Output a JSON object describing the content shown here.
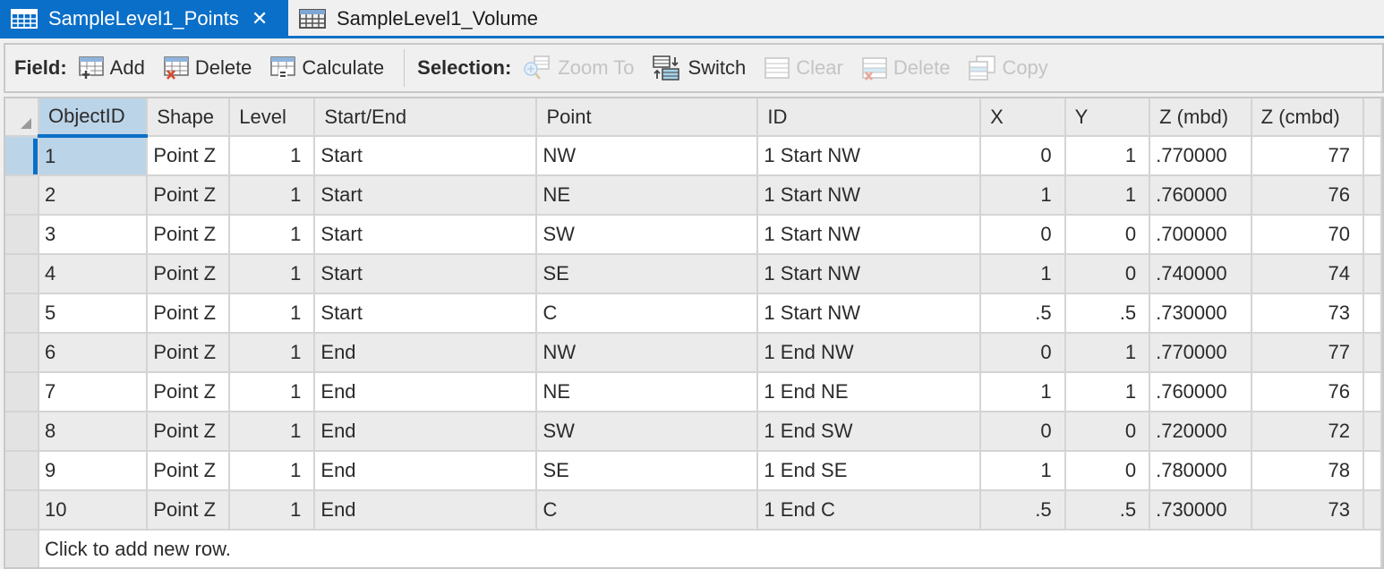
{
  "tabs": [
    {
      "label": "SampleLevel1_Points",
      "active": true,
      "closable": true,
      "icon": "table-icon"
    },
    {
      "label": "SampleLevel1_Volume",
      "active": false,
      "closable": false,
      "icon": "table-icon"
    }
  ],
  "toolbar": {
    "field_label": "Field:",
    "field_buttons": [
      {
        "label": "Add",
        "icon": "add-field-icon",
        "enabled": true
      },
      {
        "label": "Delete",
        "icon": "delete-field-icon",
        "enabled": true
      },
      {
        "label": "Calculate",
        "icon": "calculate-field-icon",
        "enabled": true
      }
    ],
    "selection_label": "Selection:",
    "selection_buttons": [
      {
        "label": "Zoom To",
        "icon": "zoom-to-icon",
        "enabled": false
      },
      {
        "label": "Switch",
        "icon": "switch-selection-icon",
        "enabled": true
      },
      {
        "label": "Clear",
        "icon": "clear-selection-icon",
        "enabled": false
      },
      {
        "label": "Delete",
        "icon": "delete-selection-icon",
        "enabled": false
      },
      {
        "label": "Copy",
        "icon": "copy-selection-icon",
        "enabled": false
      }
    ]
  },
  "table": {
    "columns": [
      "ObjectID",
      "Shape",
      "Level",
      "Start/End",
      "Point",
      "ID",
      "X",
      "Y",
      "Z (mbd)",
      "Z (cmbd)"
    ],
    "selected_column": "ObjectID",
    "selected_row": 0,
    "rows": [
      [
        "1",
        "Point Z",
        "1",
        "Start",
        "NW",
        "1 Start NW",
        "0",
        "1",
        ".770000",
        "77"
      ],
      [
        "2",
        "Point Z",
        "1",
        "Start",
        "NE",
        "1 Start NW",
        "1",
        "1",
        ".760000",
        "76"
      ],
      [
        "3",
        "Point Z",
        "1",
        "Start",
        "SW",
        "1 Start NW",
        "0",
        "0",
        ".700000",
        "70"
      ],
      [
        "4",
        "Point Z",
        "1",
        "Start",
        "SE",
        "1 Start NW",
        "1",
        "0",
        ".740000",
        "74"
      ],
      [
        "5",
        "Point Z",
        "1",
        "Start",
        "C",
        "1 Start NW",
        ".5",
        ".5",
        ".730000",
        "73"
      ],
      [
        "6",
        "Point Z",
        "1",
        "End",
        "NW",
        "1 End NW",
        "0",
        "1",
        ".770000",
        "77"
      ],
      [
        "7",
        "Point Z",
        "1",
        "End",
        "NE",
        "1 End NE",
        "1",
        "1",
        ".760000",
        "76"
      ],
      [
        "8",
        "Point Z",
        "1",
        "End",
        "SW",
        "1 End SW",
        "0",
        "0",
        ".720000",
        "72"
      ],
      [
        "9",
        "Point Z",
        "1",
        "End",
        "SE",
        "1 End SE",
        "1",
        "0",
        ".780000",
        "78"
      ],
      [
        "10",
        "Point Z",
        "1",
        "End",
        "C",
        "1 End C",
        ".5",
        ".5",
        ".730000",
        "73"
      ]
    ],
    "new_row_prompt": "Click to add new row."
  },
  "colors": {
    "accent": "#0a6fc8",
    "selected_cell": "#bcd4e8",
    "alt_row": "#ebebeb"
  }
}
